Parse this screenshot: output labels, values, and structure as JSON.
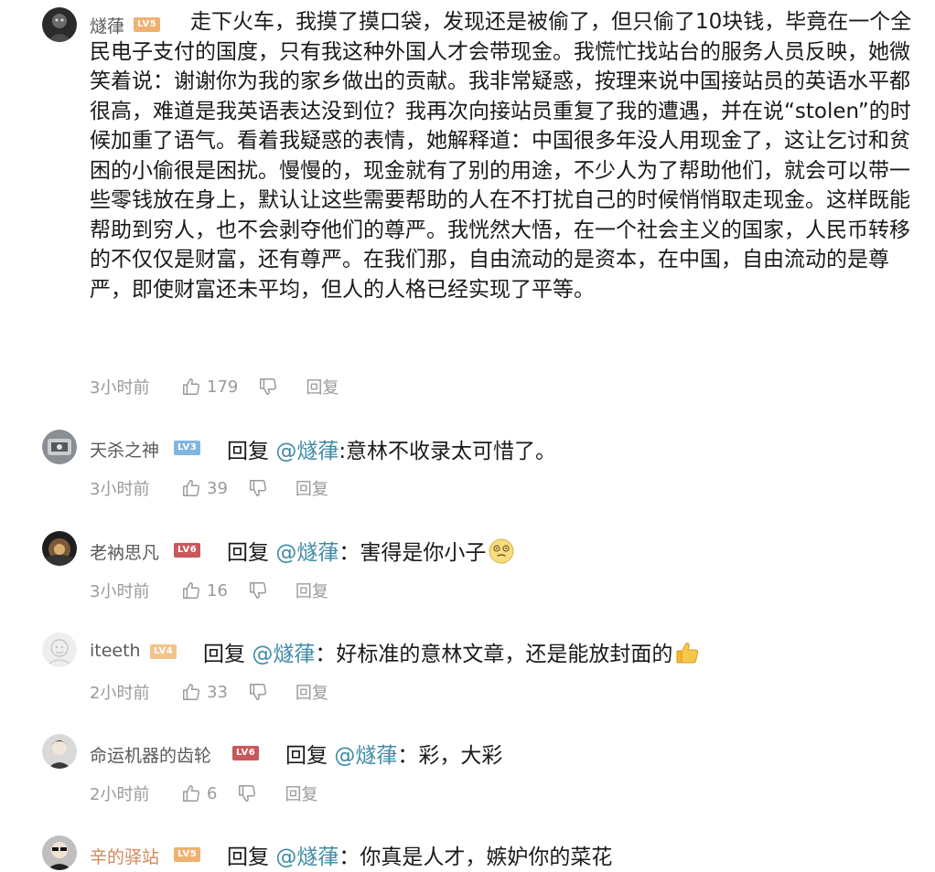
{
  "comments": [
    {
      "username": "燧葎",
      "level": "LV5",
      "text": "走下火车，我摸了摸口袋，发现还是被偷了，但只偷了10块钱，毕竟在一个全民电子支付的国度，只有我这种外国人才会带现金。我慌忙找站台的服务人员反映，她微笑着说：谢谢你为我的家乡做出的贡献。我非常疑惑，按理来说中国接站员的英语水平都很高，难道是我英语表达没到位？我再次向接站员重复了我的遭遇，并在说“stolen”的时候加重了语气。看着我疑惑的表情，她解释道：中国很多年没人用现金了，这让乞讨和贫困的小偷很是困扰。慢慢的，现金就有了别的用途，不少人为了帮助他们，就会可以带一些零钱放在身上，默认让这些需要帮助的人在不打扰自己的时候悄悄取走现金。这样既能帮助到穷人，也不会剥夺他们的尊严。我恍然大悟，在一个社会主义的国家，人民币转移的不仅仅是财富，还有尊严。在我们那，自由流动的是资本，在中国，自由流动的是尊严，即使财富还未平均，但人的人格已经实现了平等。",
      "time": "3小时前",
      "likes": "179",
      "reply_label": "回复"
    },
    {
      "username": "天杀之神",
      "level": "LV3",
      "reply_prefix": "回复",
      "mention": "@燧葎",
      "text": ":意林不收录太可惜了。",
      "time": "3小时前",
      "likes": "39",
      "reply_label": "回复"
    },
    {
      "username": "老衲思凡",
      "level": "LV6",
      "reply_prefix": "回复",
      "mention": "@燧葎",
      "text": "：害得是你小子",
      "emoji": "dizzy-face-emoji",
      "time": "3小时前",
      "likes": "16",
      "reply_label": "回复"
    },
    {
      "username": "iteeth",
      "level": "LV4",
      "reply_prefix": "回复",
      "mention": "@燧葎",
      "text": "：好标准的意林文章，还是能放封面的",
      "emoji": "thumbs-up-emoji",
      "time": "2小时前",
      "likes": "33",
      "reply_label": "回复"
    },
    {
      "username": "命运机器的齿轮",
      "level": "LV6",
      "reply_prefix": "回复",
      "mention": "@燧葎",
      "text": "：彩，大彩",
      "time": "2小时前",
      "likes": "6",
      "reply_label": "回复"
    },
    {
      "username": "辛的驿站",
      "level": "LV5",
      "reply_prefix": "回复",
      "mention": "@燧葎",
      "text": "：你真是人才，嫉妒你的菜花"
    }
  ],
  "colors": {
    "mention": "#3f8aa6",
    "lv3": "#7fb6e0",
    "lv4": "#f2c48a",
    "lv5": "#f0b070",
    "lv6": "#c9575b",
    "meta": "#9a9a9a"
  }
}
